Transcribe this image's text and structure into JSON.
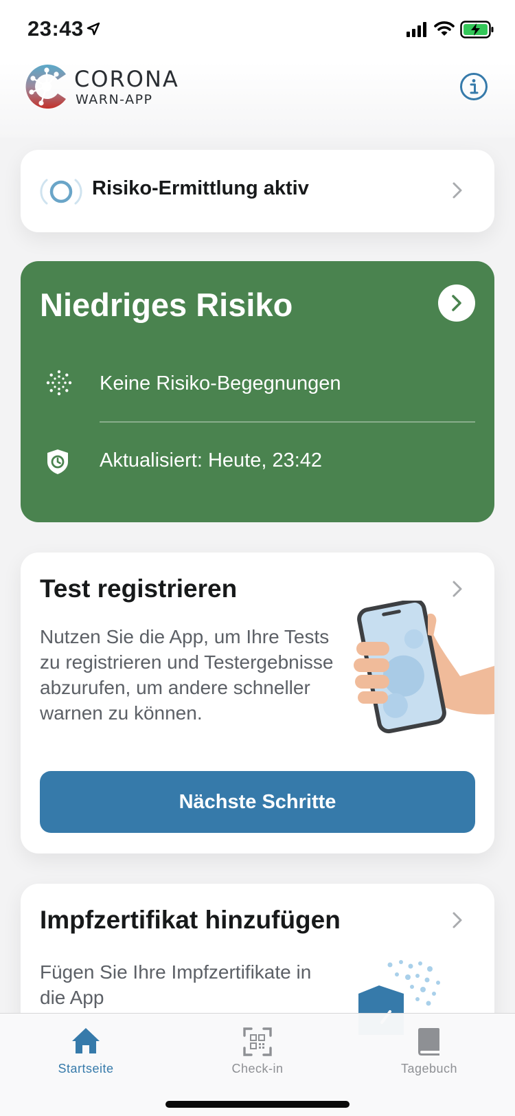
{
  "status_bar": {
    "time": "23:43",
    "icons": [
      "location-arrow-icon",
      "cellular-signal-icon",
      "wifi-icon",
      "battery-charging-icon"
    ]
  },
  "header": {
    "logo_line1": "CORONA",
    "logo_line2": "WARN-APP",
    "info_icon": "info-icon"
  },
  "risk_detection": {
    "label": "Risiko-Ermittlung aktiv"
  },
  "risk_card": {
    "title": "Niedriges Risiko",
    "encounters": "Keine Risiko-Begegnungen",
    "updated": "Aktualisiert: Heute, 23:42",
    "color": "#4a834f"
  },
  "test_card": {
    "title": "Test registrieren",
    "description": "Nutzen Sie die App, um Ihre Tests zu registrieren und Testergebnisse abzurufen, um andere schneller warnen zu können.",
    "button_label": "Nächste Schritte",
    "button_color": "#367aaa"
  },
  "vaccination_card": {
    "title": "Impfzertifikat hinzufügen",
    "description": "Fügen Sie Ihre Impfzertifikate in die App"
  },
  "tab_bar": {
    "tabs": [
      {
        "label": "Startseite",
        "icon": "home-icon",
        "active": true
      },
      {
        "label": "Check-in",
        "icon": "qr-code-icon",
        "active": false
      },
      {
        "label": "Tagebuch",
        "icon": "book-icon",
        "active": false
      }
    ],
    "active_color": "#367aaa",
    "inactive_color": "#8e9094"
  }
}
